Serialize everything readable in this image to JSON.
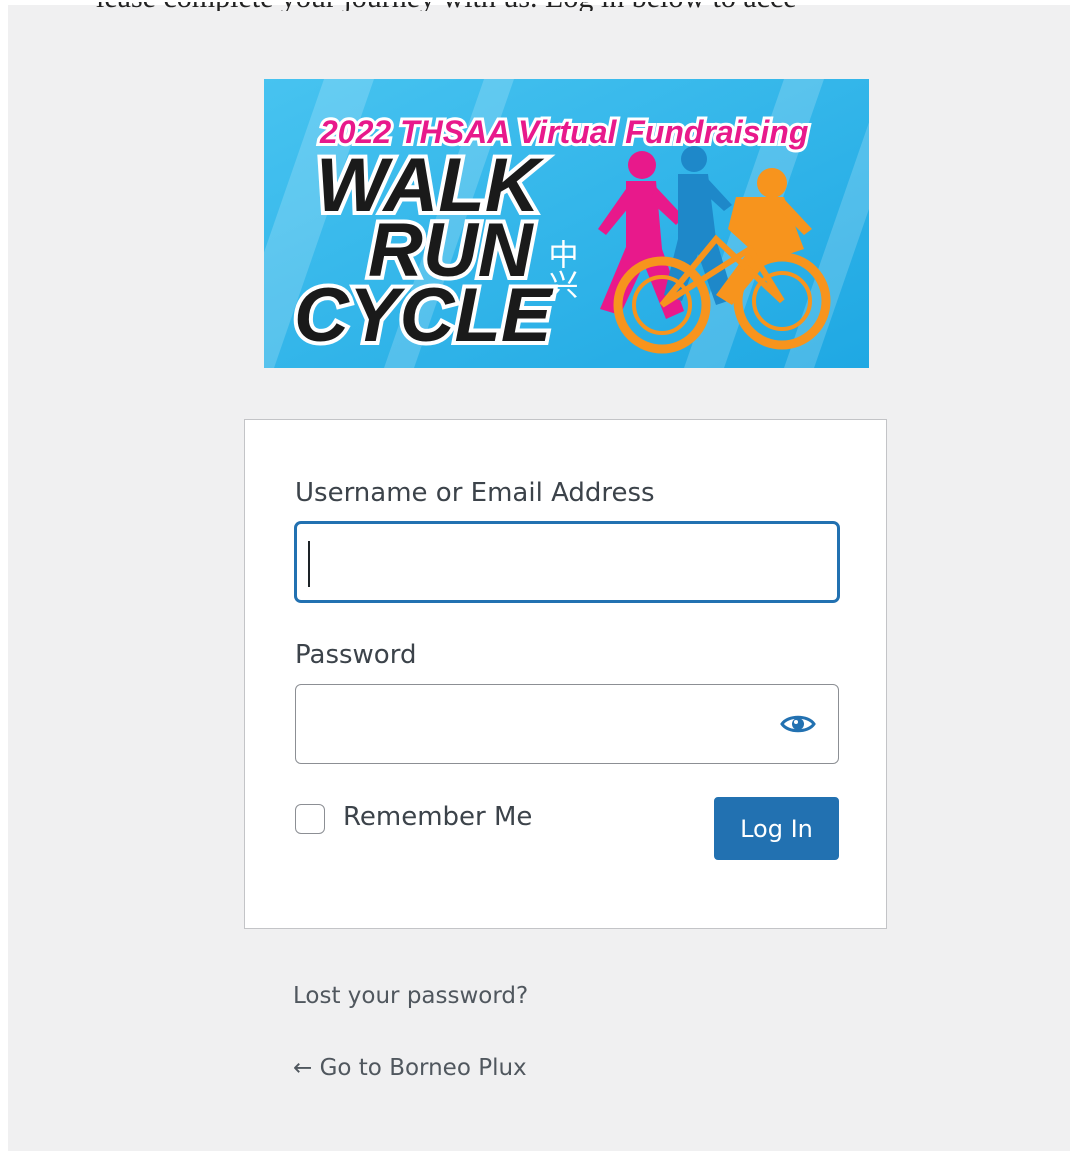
{
  "header": {
    "partial_text": "lease complete your journey with us. Log in below to access the fund..."
  },
  "logo": {
    "headline": "2022 THSAA Virtual Fundraising",
    "line1": "WALK",
    "line2": "RUN",
    "line3": "CYCLE",
    "chinese": "中兴"
  },
  "form": {
    "username_label": "Username or Email Address",
    "username_value": "",
    "password_label": "Password",
    "password_value": "",
    "remember_label": "Remember Me",
    "login_button": "Log In"
  },
  "links": {
    "lost_password": "Lost your password?",
    "back_to_site": "← Go to Borneo Plux"
  },
  "colors": {
    "accent": "#2271b1",
    "background": "#f0f0f1",
    "logo_blue": "#29b6ea",
    "logo_pink": "#e8198b",
    "logo_orange": "#f7941d"
  },
  "icons": {
    "password_toggle": "eye-icon"
  }
}
